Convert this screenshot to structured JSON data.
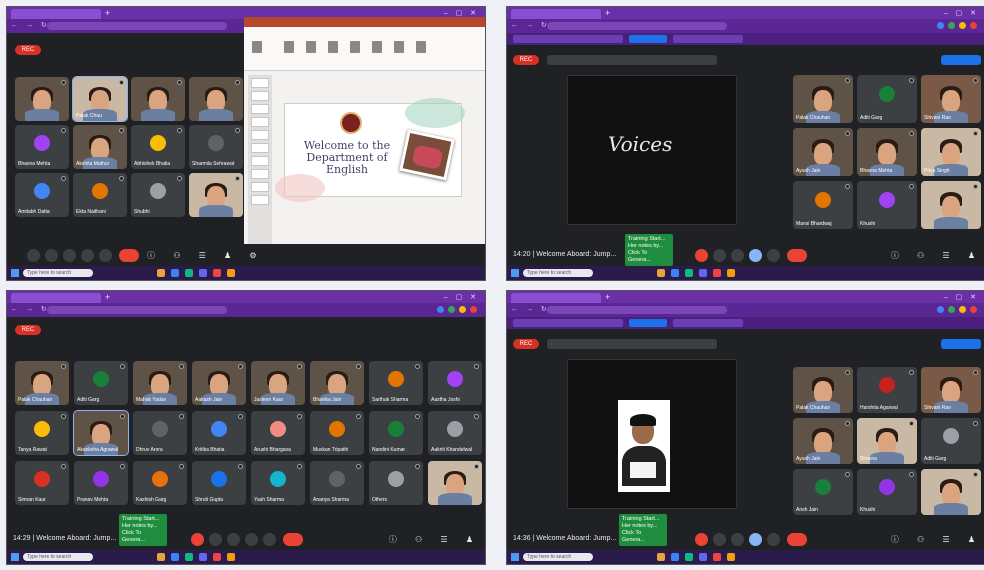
{
  "colors": {
    "meet_bg": "#202124",
    "tile_bg": "#3c4043",
    "browser_purple": "#6b2fa8",
    "end_call_red": "#ea4335",
    "toast_green": "#1e8e3e",
    "accent_blue": "#8ab4f8"
  },
  "q1": {
    "rec_label": "REC",
    "tiles": [
      {
        "name": ""
      },
      {
        "name": "Palak Chau"
      },
      {
        "name": ""
      },
      {
        "name": ""
      },
      {
        "name": "Bhavna Mehta"
      },
      {
        "name": "Akshita Mathur"
      },
      {
        "name": "Abhishek Bhatia"
      },
      {
        "name": "Sharmila Sehrawat"
      },
      {
        "name": "Amitabh Datta"
      },
      {
        "name": "Ekta Naithani"
      },
      {
        "name": "Shubhi"
      },
      {
        "name": ""
      }
    ],
    "slide": {
      "title": "Welcome to the Department of English"
    }
  },
  "q2": {
    "rec_label": "REC",
    "shared_text": "Voices",
    "meeting_label": "14:20 | Welcome Aboard: Jump...",
    "toast": "Training Start... Her notes by... Click To Genera...",
    "tiles": [
      {
        "name": "Palak Chauhan"
      },
      {
        "name": "Aditi Garg"
      },
      {
        "name": "Shivani Rao"
      },
      {
        "name": "Ayush Jain"
      },
      {
        "name": "Bhavna Mehta"
      },
      {
        "name": "Priya Singh"
      },
      {
        "name": "Mansi Bhardwaj"
      },
      {
        "name": "Khushi"
      },
      {
        "name": ""
      }
    ],
    "taskbar_search": "Type here to search"
  },
  "q3": {
    "rec_label": "REC",
    "meeting_label": "14:29 | Welcome Aboard: Jump...",
    "toast": "Training Start... Her notes by... Click To Genera...",
    "tiles": [
      {
        "name": "Palak Chauhan"
      },
      {
        "name": "Aditi Garg"
      },
      {
        "name": "Mahak Yadav"
      },
      {
        "name": "Aakash Jain"
      },
      {
        "name": "Jasleen Kaur"
      },
      {
        "name": "Bhavika Jain"
      },
      {
        "name": "Sarthak Sharma"
      },
      {
        "name": "Aastha Joshi"
      },
      {
        "name": "Tanya Rawat"
      },
      {
        "name": "Akanksha Agrawal"
      },
      {
        "name": "Dhruv Arora"
      },
      {
        "name": "Kritika Bhatia"
      },
      {
        "name": "Arushi Bhargava"
      },
      {
        "name": "Muskan Tripathi"
      },
      {
        "name": "Nandini Kumar"
      },
      {
        "name": "Aakriti Khandelwal"
      },
      {
        "name": "Simran Kaur"
      },
      {
        "name": "Pranav Mehta"
      },
      {
        "name": "Kashish Garg"
      },
      {
        "name": "Shruti Gupta"
      },
      {
        "name": "Yash Sharma"
      },
      {
        "name": "Ananya Sharma"
      },
      {
        "name": "Others"
      },
      {
        "name": ""
      }
    ],
    "taskbar_search": "Type here to search"
  },
  "q4": {
    "rec_label": "REC",
    "meeting_label": "14:36 | Welcome Aboard: Jump...",
    "toast": "Training Start... Her notes by... Click To Genera...",
    "tiles": [
      {
        "name": "Palak Chauhan"
      },
      {
        "name": "Harshita Agarwal"
      },
      {
        "name": "Shivani Rao"
      },
      {
        "name": "Ayush Jain"
      },
      {
        "name": "Bhavna"
      },
      {
        "name": "Aditi Garg"
      },
      {
        "name": "Ansh Jain"
      },
      {
        "name": "Khushi"
      },
      {
        "name": ""
      }
    ],
    "taskbar_search": "Type here to search"
  }
}
